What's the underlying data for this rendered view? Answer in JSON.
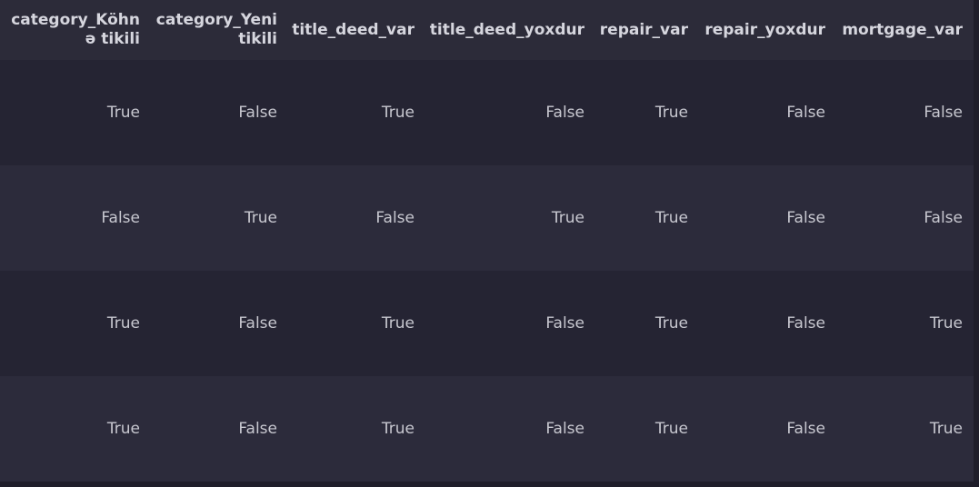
{
  "columns": [
    "category_Köhnə tikili",
    "category_Yeni tikili",
    "title_deed_var",
    "title_deed_yoxdur",
    "repair_var",
    "repair_yoxdur",
    "mortgage_var"
  ],
  "rows": [
    [
      "True",
      "False",
      "True",
      "False",
      "True",
      "False",
      "False"
    ],
    [
      "False",
      "True",
      "False",
      "True",
      "True",
      "False",
      "False"
    ],
    [
      "True",
      "False",
      "True",
      "False",
      "True",
      "False",
      "True"
    ],
    [
      "True",
      "False",
      "True",
      "False",
      "True",
      "False",
      "True"
    ]
  ]
}
